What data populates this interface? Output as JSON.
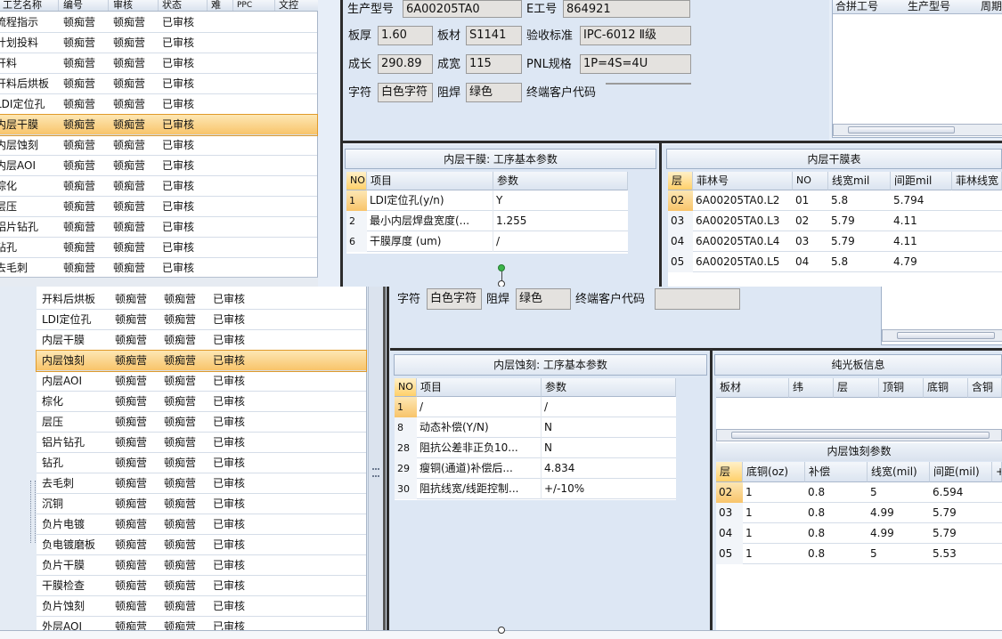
{
  "left_back": {
    "headers": [
      "工艺名称",
      "编号",
      "审核",
      "状态",
      "难",
      "PPC",
      "文控"
    ],
    "rows": [
      [
        "流程指示",
        "顿痴营",
        "顿痴营",
        "已审核"
      ],
      [
        "计划投料",
        "顿痴营",
        "顿痴营",
        "已审核"
      ],
      [
        "开料",
        "顿痴营",
        "顿痴营",
        "已审核"
      ],
      [
        "开料后烘板",
        "顿痴营",
        "顿痴营",
        "已审核"
      ],
      [
        "LDI定位孔",
        "顿痴营",
        "顿痴营",
        "已审核"
      ],
      [
        "内层干膜",
        "顿痴营",
        "顿痴营",
        "已审核"
      ],
      [
        "内层蚀刻",
        "顿痴营",
        "顿痴营",
        "已审核"
      ],
      [
        "内层AOI",
        "顿痴营",
        "顿痴营",
        "已审核"
      ],
      [
        "棕化",
        "顿痴营",
        "顿痴营",
        "已审核"
      ],
      [
        "层压",
        "顿痴营",
        "顿痴营",
        "已审核"
      ],
      [
        "铝片钻孔",
        "顿痴营",
        "顿痴营",
        "已审核"
      ],
      [
        "钻孔",
        "顿痴营",
        "顿痴营",
        "已审核"
      ],
      [
        "去毛刺",
        "顿痴营",
        "顿痴营",
        "已审核"
      ]
    ]
  },
  "left_front": {
    "rows": [
      [
        "开料后烘板",
        "顿痴营",
        "顿痴营",
        "已审核"
      ],
      [
        "LDI定位孔",
        "顿痴营",
        "顿痴营",
        "已审核"
      ],
      [
        "内层干膜",
        "顿痴营",
        "顿痴营",
        "已审核"
      ],
      [
        "内层蚀刻",
        "顿痴营",
        "顿痴营",
        "已审核"
      ],
      [
        "内层AOI",
        "顿痴营",
        "顿痴营",
        "已审核"
      ],
      [
        "棕化",
        "顿痴营",
        "顿痴营",
        "已审核"
      ],
      [
        "层压",
        "顿痴营",
        "顿痴营",
        "已审核"
      ],
      [
        "铝片钻孔",
        "顿痴营",
        "顿痴营",
        "已审核"
      ],
      [
        "钻孔",
        "顿痴营",
        "顿痴营",
        "已审核"
      ],
      [
        "去毛刺",
        "顿痴营",
        "顿痴营",
        "已审核"
      ],
      [
        "沉铜",
        "顿痴营",
        "顿痴营",
        "已审核"
      ],
      [
        "负片电镀",
        "顿痴营",
        "顿痴营",
        "已审核"
      ],
      [
        "负电镀磨板",
        "顿痴营",
        "顿痴营",
        "已审核"
      ],
      [
        "负片干膜",
        "顿痴营",
        "顿痴营",
        "已审核"
      ],
      [
        "干膜检查",
        "顿痴营",
        "顿痴营",
        "已审核"
      ],
      [
        "负片蚀刻",
        "顿痴营",
        "顿痴营",
        "已审核"
      ],
      [
        "外层AOI",
        "顿痴营",
        "顿痴营",
        "已审核"
      ]
    ]
  },
  "form": {
    "model_label": "生产型号",
    "model_value": "6A00205TA0",
    "eno_label": "E工号",
    "eno_value": "864921",
    "thick_label": "板厚",
    "thick_value": "1.60",
    "material_label": "板材",
    "material_value": "S1141",
    "standard_label": "验收标准",
    "standard_value": "IPC-6012 Ⅱ级",
    "length_label": "成长",
    "length_value": "290.89",
    "width_label": "成宽",
    "width_value": "115",
    "pnl_label": "PNL规格",
    "pnl_value": "1P=4S=4U",
    "char_label": "字符",
    "char_value": "白色字符",
    "mask_label": "阻焊",
    "mask_value": "绿色",
    "cust_label": "终端客户代码",
    "cust_value": ""
  },
  "merge_grid": {
    "headers": [
      "合拼工号",
      "生产型号",
      "周期"
    ]
  },
  "film_params": {
    "title": "内层干膜: 工序基本参数",
    "headers": [
      "NO",
      "项目",
      "参数"
    ],
    "rows": [
      [
        "1",
        "LDI定位孔(y/n)",
        "Y"
      ],
      [
        "2",
        "最小内层焊盘宽度(...",
        "1.255"
      ],
      [
        "6",
        "干膜厚度 (um)",
        "/"
      ]
    ]
  },
  "film_table": {
    "title": "内层干膜表",
    "headers": [
      "层",
      "菲林号",
      "NO",
      "线宽mil",
      "间距mil",
      "菲林线宽"
    ],
    "rows": [
      [
        "02",
        "6A00205TA0.L2",
        "01",
        "5.8",
        "5.794"
      ],
      [
        "03",
        "6A00205TA0.L3",
        "02",
        "5.79",
        "4.11"
      ],
      [
        "04",
        "6A00205TA0.L4",
        "03",
        "5.79",
        "4.11"
      ],
      [
        "05",
        "6A00205TA0.L5",
        "04",
        "5.8",
        "4.79"
      ]
    ]
  },
  "front_form": {
    "char_label": "字符",
    "char_value": "白色字符",
    "mask_label": "阻焊",
    "mask_value": "绿色",
    "cust_label": "终端客户代码",
    "cust_value": ""
  },
  "etch_params": {
    "title": "内层蚀刻: 工序基本参数",
    "headers": [
      "NO",
      "项目",
      "参数"
    ],
    "rows": [
      [
        "1",
        "/",
        "/"
      ],
      [
        "8",
        "动态补偿(Y/N)",
        "N"
      ],
      [
        "28",
        "阻抗公差非正负10...",
        "N"
      ],
      [
        "29",
        "瘦铜(通道)补偿后...",
        "4.834"
      ],
      [
        "30",
        "阻抗线宽/线距控制...",
        "+/-10%"
      ]
    ]
  },
  "plain_board": {
    "title": "纯光板信息",
    "headers": [
      "板材",
      "纬",
      "层",
      "顶铜",
      "底铜",
      "含铜"
    ]
  },
  "etch_table": {
    "title": "内层蚀刻参数",
    "headers": [
      "层",
      "底铜(oz)",
      "补偿",
      "线宽(mil)",
      "间距(mil)",
      "+"
    ],
    "rows": [
      [
        "02",
        "1",
        "0.8",
        "5",
        "6.594"
      ],
      [
        "03",
        "1",
        "0.8",
        "4.99",
        "5.79"
      ],
      [
        "04",
        "1",
        "0.8",
        "4.99",
        "5.79"
      ],
      [
        "05",
        "1",
        "0.8",
        "5",
        "5.53"
      ]
    ]
  }
}
